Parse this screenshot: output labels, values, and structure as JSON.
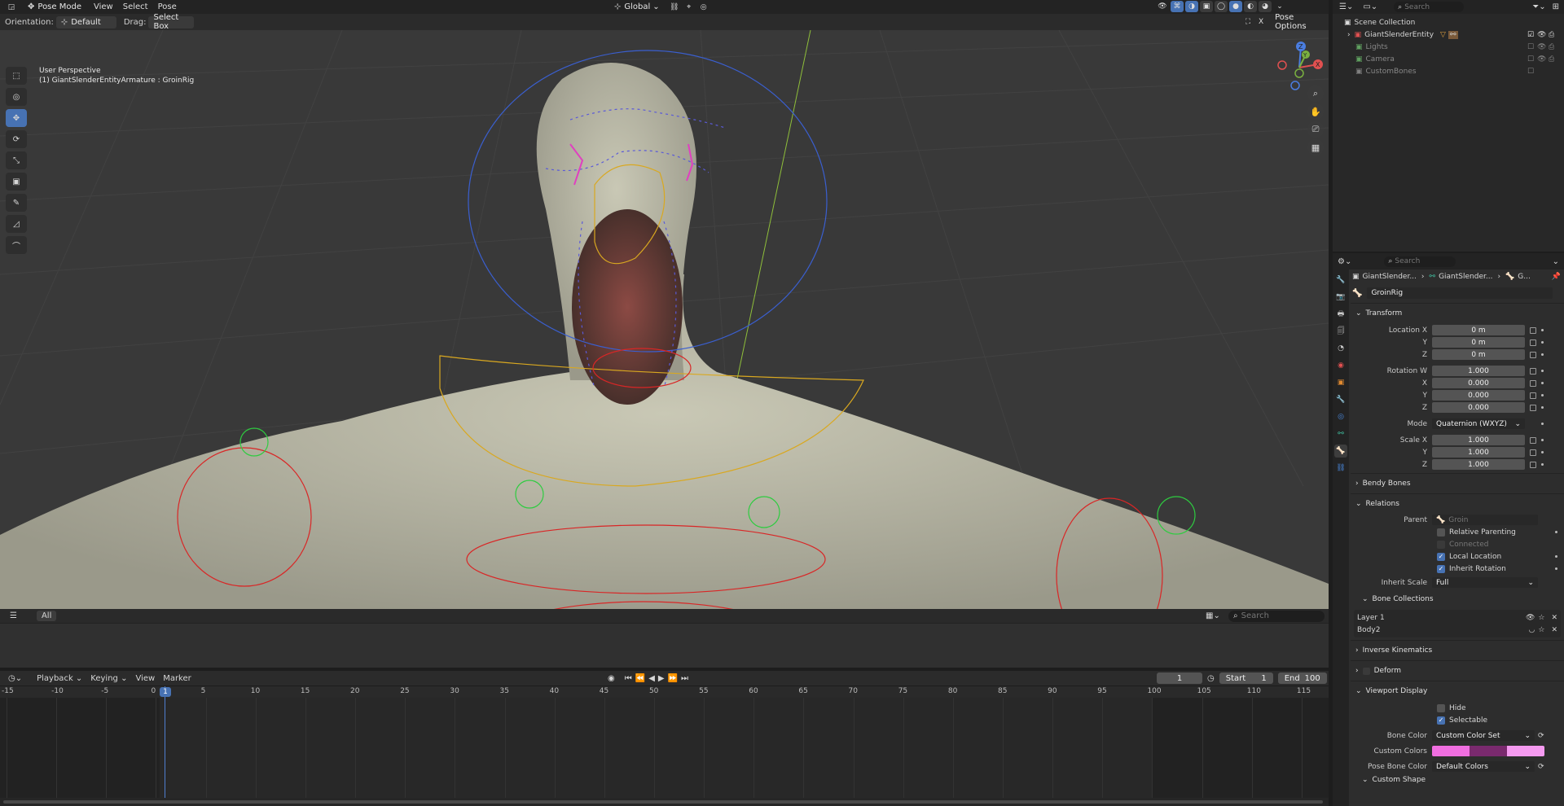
{
  "topbar": {
    "mode": "Pose Mode",
    "menus": [
      "View",
      "Select",
      "Pose"
    ],
    "transform_orientation": "Global",
    "search_placeholder": "Search"
  },
  "header2": {
    "orientation_label": "Orientation:",
    "orientation_value": "Default",
    "drag_label": "Drag:",
    "drag_value": "Select Box",
    "pose_options": "Pose Options"
  },
  "viewport": {
    "perspective": "User Perspective",
    "object_info": "(1) GiantSlenderEntityArmature : GroinRig",
    "gizmo": {
      "x": "X",
      "y": "Y",
      "z": "Z"
    },
    "colors": {
      "background": "#393939",
      "mesh": "#bdbca9",
      "bone_red": "#d92626",
      "bone_blue": "#3a5fd0",
      "bone_yellow": "#d9a820",
      "bone_green": "#2ecc40",
      "bone_pink": "#e040c0"
    }
  },
  "shelf": {
    "tab": "All",
    "search_placeholder": "Search"
  },
  "timeline": {
    "menus": [
      "Playback",
      "Keying",
      "View",
      "Marker"
    ],
    "current_frame": "1",
    "start_label": "Start",
    "start": "1",
    "end_label": "End",
    "end": "100",
    "playhead_frame": "1",
    "ticks": [
      "-15",
      "-10",
      "-5",
      "0",
      "5",
      "10",
      "15",
      "20",
      "25",
      "30",
      "35",
      "40",
      "45",
      "50",
      "55",
      "60",
      "65",
      "70",
      "75",
      "80",
      "85",
      "90",
      "95",
      "100",
      "105",
      "110",
      "115"
    ]
  },
  "outliner": {
    "search_placeholder": "Search",
    "root": "Scene Collection",
    "items": [
      {
        "name": "GiantSlenderEntity",
        "color": "#e05050"
      },
      {
        "name": "Lights",
        "color": "#60a060"
      },
      {
        "name": "Camera",
        "color": "#60a060"
      },
      {
        "name": "CustomBones",
        "color": "#808080"
      }
    ]
  },
  "properties": {
    "search_placeholder": "Search",
    "breadcrumb": [
      "GiantSlender...",
      "GiantSlender...",
      "G..."
    ],
    "bone_name": "GroinRig",
    "transform": {
      "title": "Transform",
      "location_label": "Location X",
      "y": "Y",
      "z": "Z",
      "x": "X",
      "w": "W",
      "location": [
        "0 m",
        "0 m",
        "0 m"
      ],
      "rotation_label": "Rotation W",
      "rotation": [
        "1.000",
        "0.000",
        "0.000",
        "0.000"
      ],
      "mode_label": "Mode",
      "mode": "Quaternion (WXYZ)",
      "scale_label": "Scale X",
      "scale": [
        "1.000",
        "1.000",
        "1.000"
      ]
    },
    "bendy_bones": "Bendy Bones",
    "relations": {
      "title": "Relations",
      "parent_label": "Parent",
      "parent": "Groin",
      "relative_parenting": "Relative Parenting",
      "connected": "Connected",
      "local_location": "Local Location",
      "inherit_rotation": "Inherit Rotation",
      "inherit_scale_label": "Inherit Scale",
      "inherit_scale": "Full"
    },
    "bone_collections": {
      "title": "Bone Collections",
      "items": [
        "Layer 1",
        "Body2"
      ]
    },
    "inverse_kinematics": "Inverse Kinematics",
    "deform": "Deform",
    "viewport_display": {
      "title": "Viewport Display",
      "hide": "Hide",
      "selectable": "Selectable",
      "bone_color_label": "Bone Color",
      "bone_color": "Custom Color Set",
      "custom_colors_label": "Custom Colors",
      "custom_colors": [
        "#f06ee0",
        "#7a2a6e",
        "#f59af0"
      ],
      "pose_bone_color_label": "Pose Bone Color",
      "pose_bone_color": "Default Colors"
    },
    "custom_shape": "Custom Shape"
  }
}
